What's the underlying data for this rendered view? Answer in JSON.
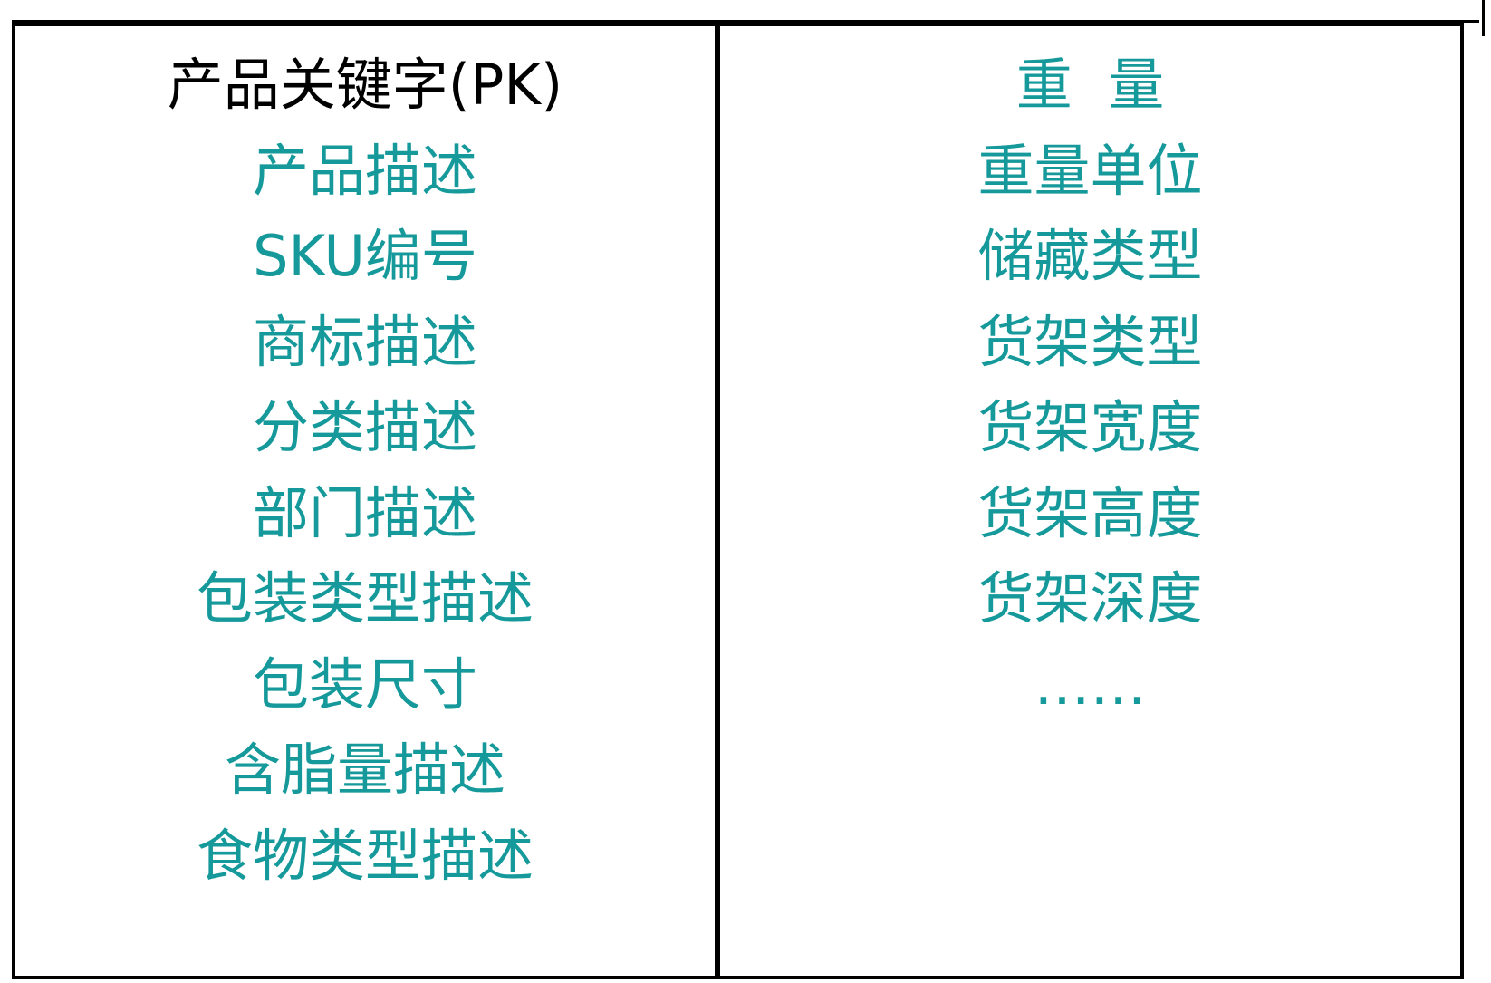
{
  "colors": {
    "key_text": "#000000",
    "attribute_text": "#16999a",
    "border": "#000000"
  },
  "left_entity": {
    "primary_key": "产品关键字(PK)",
    "attributes": [
      "产品描述",
      "SKU编号",
      "商标描述",
      "分类描述",
      "部门描述",
      "包装类型描述",
      "包装尺寸",
      "含脂量描述",
      "食物类型描述"
    ]
  },
  "right_entity": {
    "attributes": [
      "重  量",
      "重量单位",
      "储藏类型",
      "货架类型",
      "货架宽度",
      "货架高度",
      "货架深度",
      "……"
    ]
  }
}
